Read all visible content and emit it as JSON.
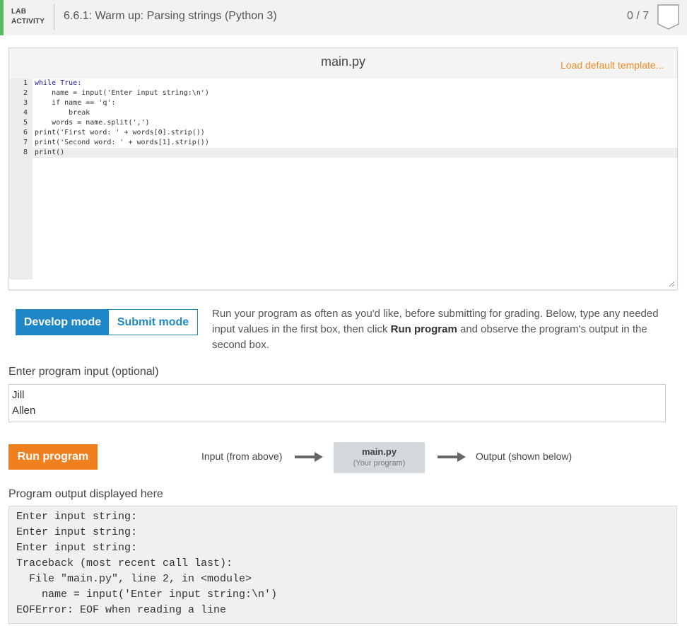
{
  "header": {
    "lab_label_1": "LAB",
    "lab_label_2": "ACTIVITY",
    "title": "6.6.1: Warm up: Parsing strings (Python 3)",
    "score": "0 / 7",
    "accent_color": "#5cb85c"
  },
  "editor": {
    "filename": "main.py",
    "load_template": "Load default template...",
    "line_numbers": [
      "1",
      "2",
      "3",
      "4",
      "5",
      "6",
      "7",
      "8"
    ],
    "code_lines": [
      "while True:",
      "    name = input('Enter input string:\\n')",
      "    if name == 'q':",
      "        break",
      "    words = name.split(',')",
      "print('First word: ' + words[0].strip())",
      "print('Second word: ' + words[1].strip())",
      "print()"
    ]
  },
  "mode": {
    "develop_label": "Develop mode",
    "submit_label": "Submit mode",
    "desc_part1": "Run your program as often as you'd like, before submitting for grading. Below, type any needed input values in the first box, then click ",
    "desc_bold": "Run program",
    "desc_part2": " and observe the program's output in the second box.",
    "accent_color": "#1e88c7"
  },
  "input": {
    "label": "Enter program input (optional)",
    "value": "Jill\nAllen"
  },
  "run": {
    "button_label": "Run program",
    "button_color": "#f07f1f",
    "flow_input": "Input (from above)",
    "program_name": "main.py",
    "program_sub": "(Your program)",
    "flow_output": "Output (shown below)"
  },
  "output": {
    "label": "Program output displayed here",
    "lines": [
      "Enter input string:",
      "Enter input string:",
      "Enter input string:",
      "Traceback (most recent call last):",
      "  File \"main.py\", line 2, in <module>",
      "    name = input('Enter input string:\\n')",
      "EOFError: EOF when reading a line"
    ]
  }
}
